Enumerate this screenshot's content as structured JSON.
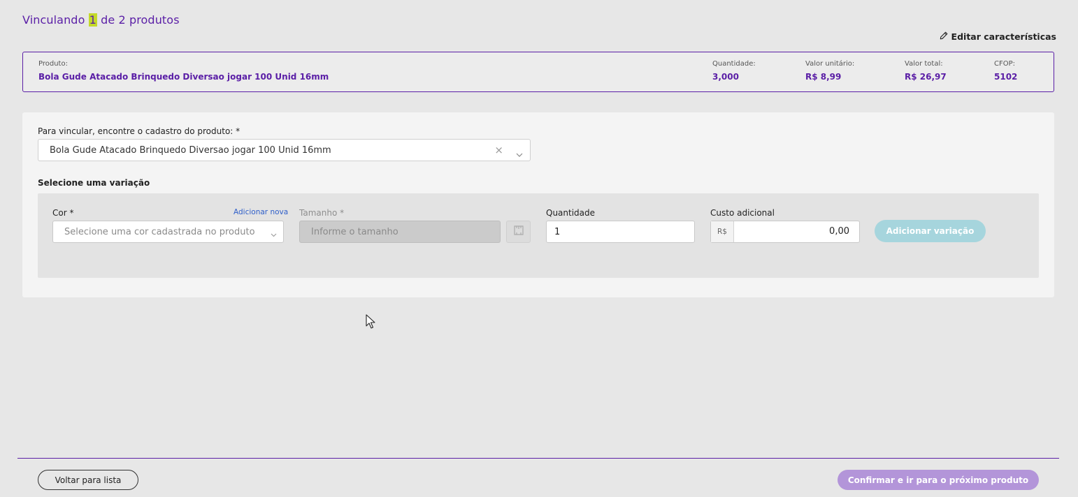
{
  "header": {
    "title_prefix": "Vinculando",
    "current": "1",
    "title_suffix": "de 2 produtos",
    "edit_label": "Editar características"
  },
  "product": {
    "produto_label": "Produto:",
    "produto_value": "Bola Gude Atacado Brinquedo Diversao jogar 100 Unid 16mm",
    "quantidade_label": "Quantidade:",
    "quantidade_value": "3,000",
    "valor_unitario_label": "Valor unitário:",
    "valor_unitario_value": "R$ 8,99",
    "valor_total_label": "Valor total:",
    "valor_total_value": "R$ 26,97",
    "cfop_label": "CFOP:",
    "cfop_value": "5102"
  },
  "link": {
    "search_label": "Para vincular, encontre o cadastro do produto: *",
    "search_value": "Bola Gude Atacado Brinquedo Diversao jogar 100 Unid 16mm",
    "clear_symbol": "×"
  },
  "variation": {
    "section_label": "Selecione uma variação",
    "cor_label": "Cor *",
    "add_new": "Adicionar nova",
    "cor_placeholder": "Selecione uma cor cadastrada no produto",
    "tamanho_label": "Tamanho *",
    "tamanho_placeholder": "Informe o tamanho",
    "quantidade_label": "Quantidade",
    "quantidade_value": "1",
    "custo_label": "Custo adicional",
    "currency_prefix": "R$",
    "custo_value": "0,00",
    "add_button": "Adicionar variação"
  },
  "footer": {
    "back_button": "Voltar para lista",
    "confirm_button": "Confirmar e ir para o próximo produto"
  },
  "colors": {
    "accent": "#5a1ea6",
    "highlight": "#c4d92a",
    "add_variation_bg": "#a6d5dd",
    "confirm_bg": "#b395d9"
  }
}
